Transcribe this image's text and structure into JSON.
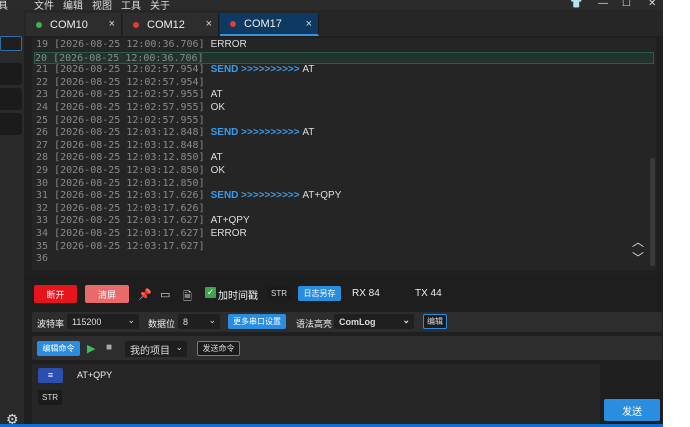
{
  "menu": [
    "具",
    "文件",
    "编辑",
    "视图",
    "工具",
    "关于"
  ],
  "tabs": [
    {
      "label": "COM10",
      "dot_color": "#39b54a",
      "close": "×"
    },
    {
      "label": "COM12",
      "dot_color": "#e53935",
      "close": "×"
    },
    {
      "label": "COM17",
      "dot_color": "#e53935",
      "close": "×",
      "active": true
    }
  ],
  "log": [
    {
      "n": "19",
      "ts": "[2026-08-25 12:00:36.706]",
      "text": "ERROR"
    },
    {
      "n": "20",
      "ts": "[2026-08-25 12:00:36.706]",
      "text": "",
      "highlight": true
    },
    {
      "n": "21",
      "ts": "[2026-08-25 12:02:57.954]",
      "send": "SEND >>>>>>>>>> ",
      "text": "AT"
    },
    {
      "n": "22",
      "ts": "[2026-08-25 12:02:57.954]",
      "text": ""
    },
    {
      "n": "23",
      "ts": "[2026-08-25 12:02:57.955]",
      "text": "AT"
    },
    {
      "n": "24",
      "ts": "[2026-08-25 12:02:57.955]",
      "text": "OK"
    },
    {
      "n": "25",
      "ts": "[2026-08-25 12:02:57.955]",
      "text": ""
    },
    {
      "n": "26",
      "ts": "[2026-08-25 12:03:12.848]",
      "send": "SEND >>>>>>>>>> ",
      "text": "AT"
    },
    {
      "n": "27",
      "ts": "[2026-08-25 12:03:12.848]",
      "text": ""
    },
    {
      "n": "28",
      "ts": "[2026-08-25 12:03:12.850]",
      "text": "AT"
    },
    {
      "n": "29",
      "ts": "[2026-08-25 12:03:12.850]",
      "text": "OK"
    },
    {
      "n": "30",
      "ts": "[2026-08-25 12:03:12.850]",
      "text": ""
    },
    {
      "n": "31",
      "ts": "[2026-08-25 12:03:17.626]",
      "send": "SEND >>>>>>>>>> ",
      "text": "AT+QPY"
    },
    {
      "n": "32",
      "ts": "[2026-08-25 12:03:17.626]",
      "text": ""
    },
    {
      "n": "33",
      "ts": "[2026-08-25 12:03:17.627]",
      "text": "AT+QPY"
    },
    {
      "n": "34",
      "ts": "[2026-08-25 12:03:17.627]",
      "text": "ERROR"
    },
    {
      "n": "35",
      "ts": "[2026-08-25 12:03:17.627]",
      "text": ""
    },
    {
      "n": "36",
      "ts": "",
      "text": ""
    }
  ],
  "controls": {
    "disconnect": "断开",
    "clear": "清屏",
    "timestamp_label": "加时间戳",
    "str": "STR",
    "save_log": "日志另存",
    "rx": "RX 84",
    "tx": "TX 44"
  },
  "settings": {
    "baud_label": "波特率",
    "baud_value": "115200",
    "databits_label": "数据位",
    "databits_value": "8",
    "more_serial": "更多串口设置",
    "syntax_label": "语法高亮",
    "syntax_value": "ComLog",
    "edit": "编辑"
  },
  "commands": {
    "edit_cmd": "编辑命令",
    "project": "我的项目",
    "send_cmd": "发送命令"
  },
  "input": {
    "text": "AT+QPY",
    "str": "STR",
    "send": "发送"
  },
  "colors": {
    "accent": "#2a8ee0",
    "disconnect": "#e8141b",
    "clear": "#e86a6a",
    "send": "#3b9be8"
  }
}
